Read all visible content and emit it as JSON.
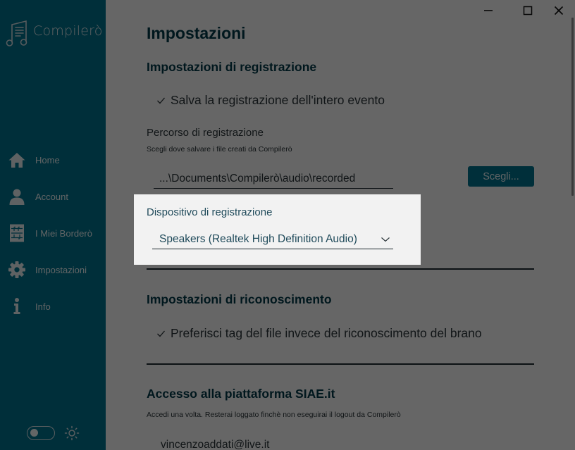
{
  "app": {
    "name": "Compilerò",
    "brand_color": "#00708a"
  },
  "window_controls": {
    "minimize": "minimize",
    "maximize": "maximize",
    "close": "close"
  },
  "sidebar": {
    "items": [
      {
        "label": "Home",
        "icon": "home-icon"
      },
      {
        "label": "Account",
        "icon": "user-icon"
      },
      {
        "label": "I Miei Borderò",
        "icon": "music-sheet-icon"
      },
      {
        "label": "Impostazioni",
        "icon": "gear-icon"
      },
      {
        "label": "Info",
        "icon": "info-icon"
      }
    ],
    "theme_toggle": {
      "dark_mode": false,
      "icon": "sun-icon"
    }
  },
  "main": {
    "title": "Impostazioni",
    "recording": {
      "title": "Impostazioni di registrazione",
      "save_full_event": {
        "label": "Salva la registrazione dell'intero evento",
        "checked": true
      },
      "path": {
        "label": "Percorso di registrazione",
        "hint": "Scegli dove salvare i file creati da Compilerò",
        "value": "...\\Documents\\Compilerò\\audio\\recorded",
        "button_label": "Scegli..."
      },
      "device": {
        "label": "Dispositivo di registrazione",
        "selected": "Speakers (Realtek High Definition Audio)"
      }
    },
    "recognition": {
      "title": "Impostazioni di riconoscimento",
      "prefer_file_tags": {
        "label": "Preferisci tag del file invece del riconoscimento del brano",
        "checked": true
      }
    },
    "siae": {
      "title": "Accesso alla piattaforma SIAE.it",
      "hint": "Accedi una volta. Resterai loggato finchè non eseguirai il logout da Compilerò",
      "email": "vincenzoaddati@live.it"
    }
  }
}
